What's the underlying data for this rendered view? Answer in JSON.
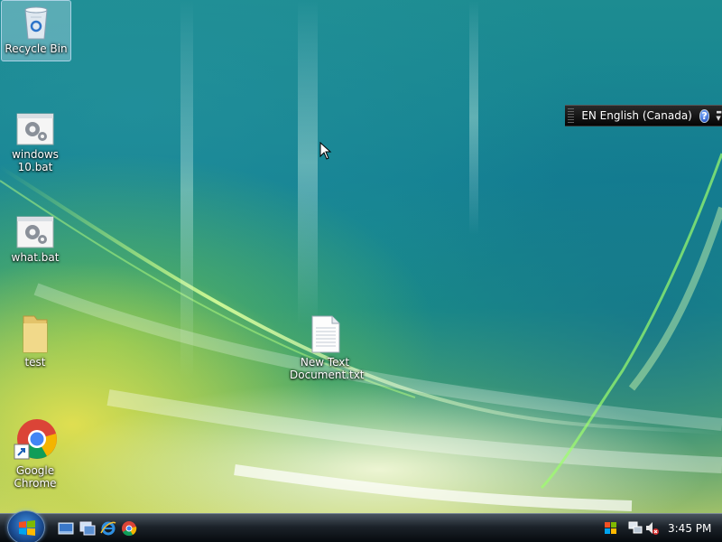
{
  "desktop": {
    "icons": [
      {
        "label": "Recycle Bin",
        "icon": "recycle-bin-icon"
      },
      {
        "label": "windows 10.bat",
        "icon": "batch-file-icon"
      },
      {
        "label": "what.bat",
        "icon": "batch-file-icon"
      },
      {
        "label": "test",
        "icon": "folder-icon"
      },
      {
        "label": "Google Chrome",
        "icon": "chrome-shortcut-icon"
      },
      {
        "label": "New Text Document.txt",
        "icon": "text-file-icon"
      }
    ]
  },
  "language_bar": {
    "text": "EN English (Canada)",
    "help": "?"
  },
  "taskbar": {
    "start_button": "start-orb-icon",
    "quick_launch": [
      "show-desktop-icon",
      "switch-windows-icon",
      "internet-explorer-icon",
      "chrome-icon"
    ],
    "tray_icons": [
      "windows-update-icon",
      "network-icon",
      "volume-muted-icon"
    ],
    "clock": "3:45 PM"
  },
  "colors": {
    "taskbar": "#0b1016",
    "language_bar": "#111111",
    "selection": "#c8e1f0"
  }
}
